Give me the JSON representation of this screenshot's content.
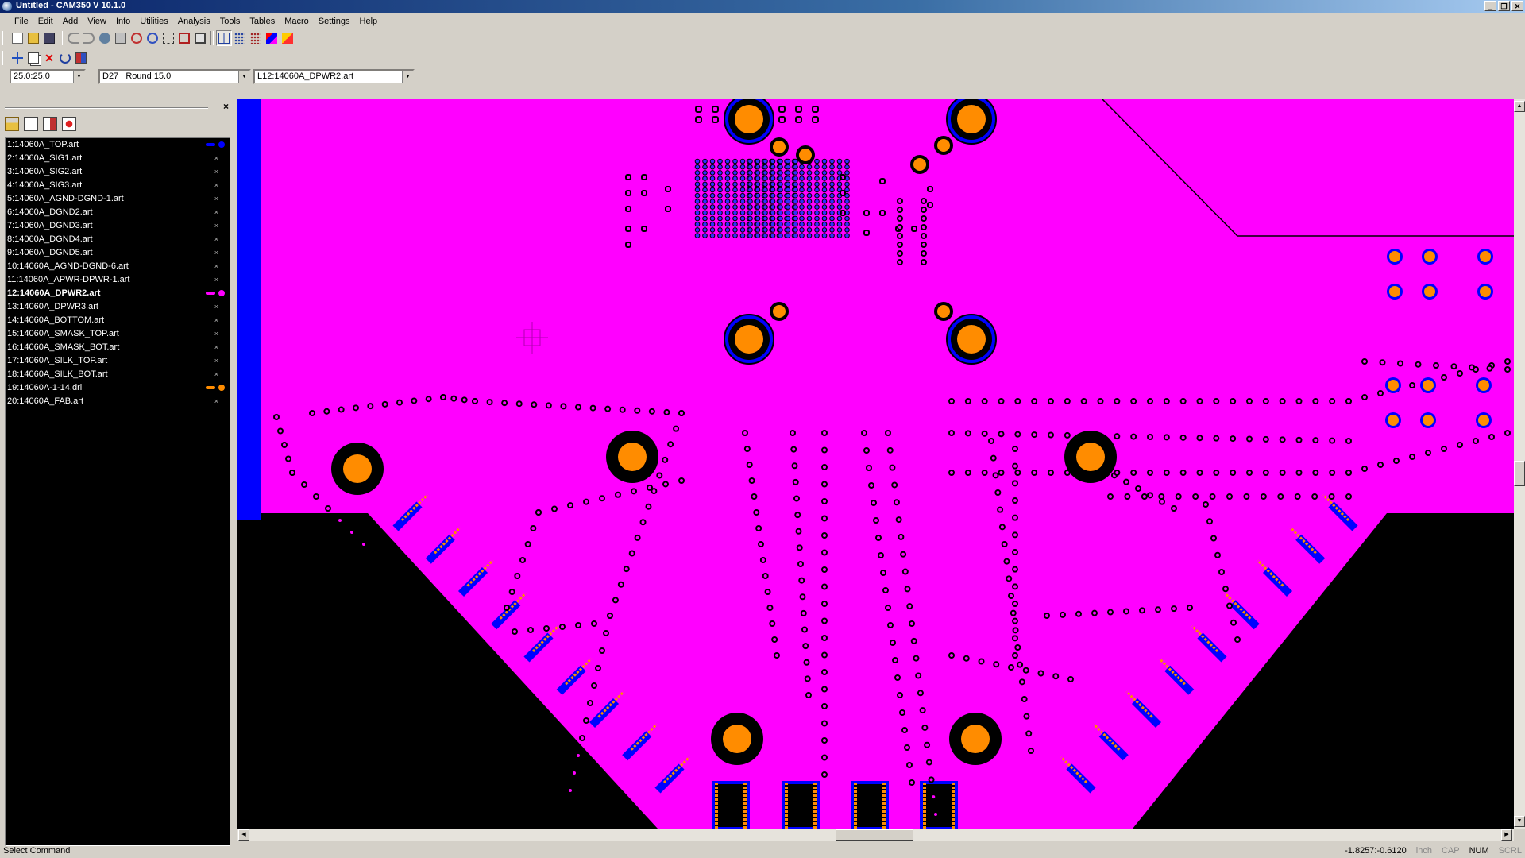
{
  "window": {
    "title": "Untitled - CAM350 V 10.1.0",
    "buttons": [
      "_",
      "❐",
      "✕"
    ]
  },
  "menu": [
    "File",
    "Edit",
    "Add",
    "View",
    "Info",
    "Utilities",
    "Analysis",
    "Tools",
    "Tables",
    "Macro",
    "Settings",
    "Help"
  ],
  "combos": {
    "grid": "25.0:25.0",
    "aperture": "D27   Round 15.0",
    "layer": "L12:14060A_DPWR2.art"
  },
  "layer_panel": {
    "close": "×",
    "layers": [
      {
        "label": "1:14060A_TOP.art",
        "color": "#0000ff",
        "visible": true
      },
      {
        "label": "2:14060A_SIG1.art",
        "visible": false
      },
      {
        "label": "3:14060A_SIG2.art",
        "visible": false
      },
      {
        "label": "4:14060A_SIG3.art",
        "visible": false
      },
      {
        "label": "5:14060A_AGND-DGND-1.art",
        "visible": false
      },
      {
        "label": "6:14060A_DGND2.art",
        "visible": false
      },
      {
        "label": "7:14060A_DGND3.art",
        "visible": false
      },
      {
        "label": "8:14060A_DGND4.art",
        "visible": false
      },
      {
        "label": "9:14060A_DGND5.art",
        "visible": false
      },
      {
        "label": "10:14060A_AGND-DGND-6.art",
        "visible": false
      },
      {
        "label": "11:14060A_APWR-DPWR-1.art",
        "visible": false
      },
      {
        "label": "12:14060A_DPWR2.art",
        "color": "#ff00ff",
        "visible": true,
        "active": true
      },
      {
        "label": "13:14060A_DPWR3.art",
        "visible": false
      },
      {
        "label": "14:14060A_BOTTOM.art",
        "visible": false
      },
      {
        "label": "15:14060A_SMASK_TOP.art",
        "visible": false
      },
      {
        "label": "16:14060A_SMASK_BOT.art",
        "visible": false
      },
      {
        "label": "17:14060A_SILK_TOP.art",
        "visible": false
      },
      {
        "label": "18:14060A_SILK_BOT.art",
        "visible": false
      },
      {
        "label": "19:14060A-1-14.drl",
        "color": "#ff8c00",
        "visible": true
      },
      {
        "label": "20:14060A_FAB.art",
        "visible": false
      }
    ],
    "hidden_marker": "×"
  },
  "colors": {
    "plane": "#ff00ff",
    "top": "#0000ff",
    "drill": "#ff8c00",
    "background": "#000000"
  },
  "status": {
    "command": "Select Command",
    "coords": "-1.8257:-0.6120",
    "unit": "inch",
    "cap": "CAP",
    "num": "NUM",
    "scrl": "SCRL"
  }
}
